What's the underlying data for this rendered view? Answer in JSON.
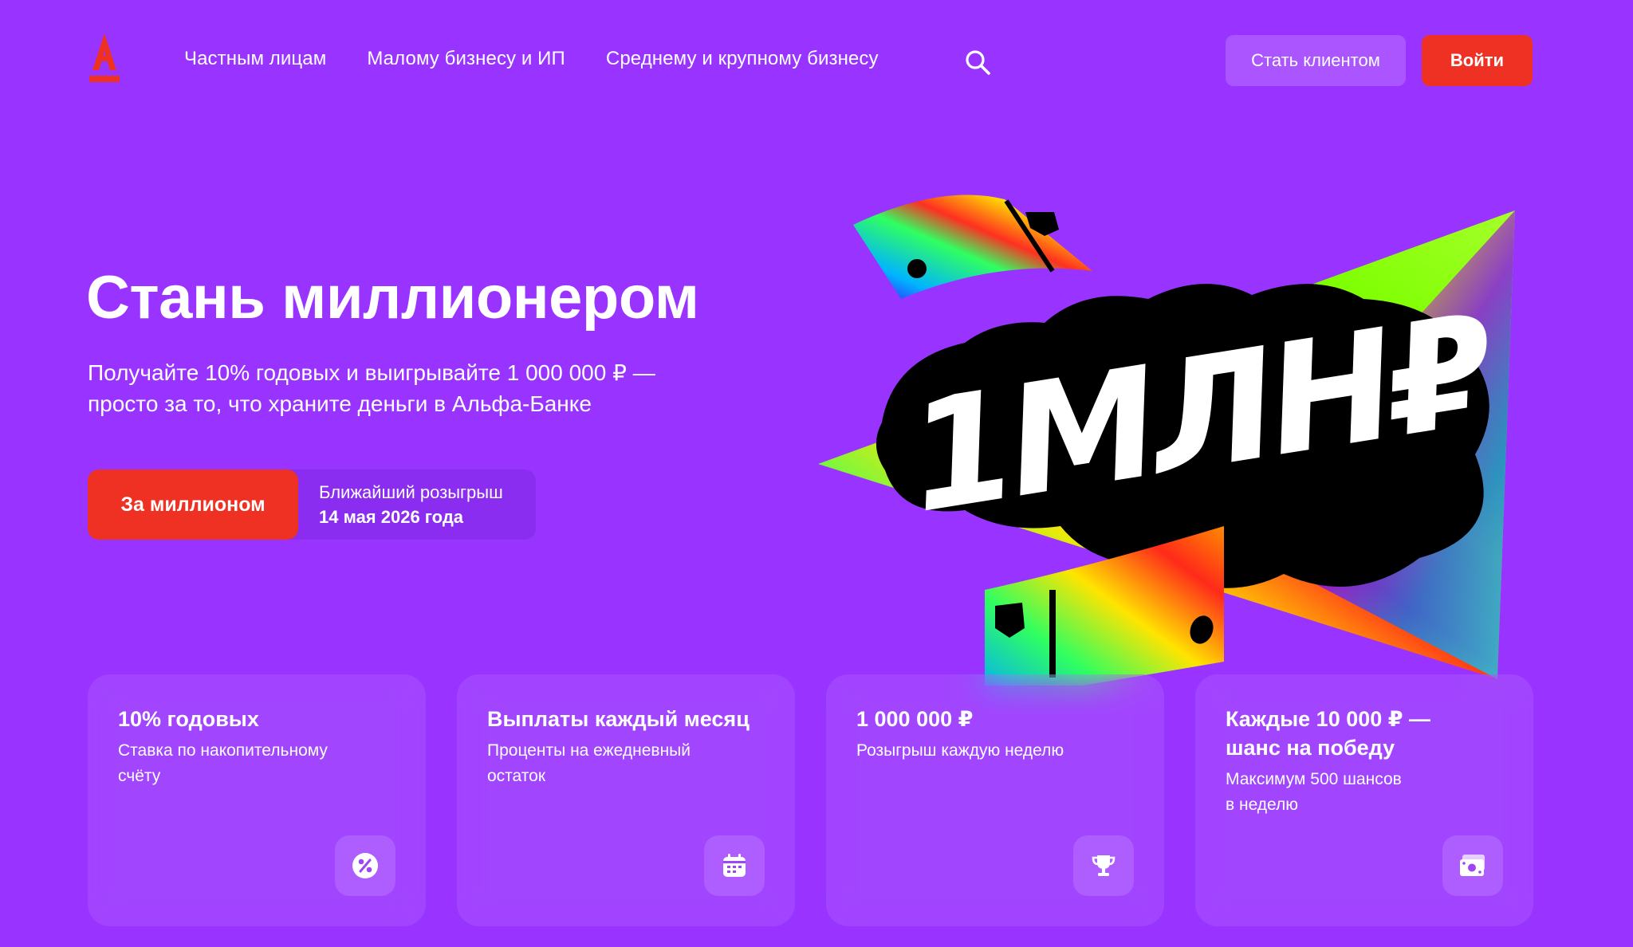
{
  "header": {
    "logo_letter": "А",
    "nav": [
      "Частным лицам",
      "Малому бизнесу и ИП",
      "Среднему и крупному бизнесу"
    ],
    "search_icon": "search-icon",
    "become_client": "Стать клиентом",
    "login": "Войти"
  },
  "hero": {
    "title": "Стань миллионером",
    "subtitle_line1": "Получайте 10% годовых и выигрывайте 1 000 000 ₽ —",
    "subtitle_line2": "просто за то, что храните деньги в Альфа-Банке",
    "cta": "За миллионом",
    "draw_label": "Ближайший розыгрыш",
    "draw_date": "14 мая 2026 года",
    "art_text": "1МЛН₽"
  },
  "cards": [
    {
      "title": "10% годовых",
      "text_line1": "Ставка по накопительному",
      "text_line2": "счёту",
      "icon": "percent-icon"
    },
    {
      "title": "Выплаты каждый месяц",
      "text_line1": "Проценты на ежедневный",
      "text_line2": "остаток",
      "icon": "calendar-icon"
    },
    {
      "title": "1 000 000 ₽",
      "text_line1": "Розыгрыш каждую неделю",
      "text_line2": "",
      "icon": "trophy-icon"
    },
    {
      "title_line1": "Каждые 10 000 ₽ —",
      "title_line2": "шанс на победу",
      "text_line1": "Максимум 500 шансов",
      "text_line2": "в неделю",
      "icon": "money-icon"
    }
  ],
  "colors": {
    "background": "#9933ff",
    "accent_red": "#ef3124",
    "button_light_purple": "#aa55ff",
    "white": "#ffffff"
  }
}
